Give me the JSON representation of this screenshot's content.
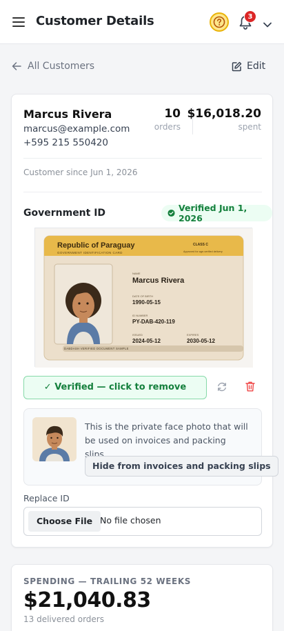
{
  "header": {
    "title": "Customer Details",
    "notification_count": "3",
    "icons": [
      "menu-icon",
      "help-icon",
      "bell-icon",
      "chevron-down-icon"
    ]
  },
  "nav": {
    "back_label": "All Customers",
    "edit_label": "Edit"
  },
  "customer": {
    "name": "Marcus Rivera",
    "email": "marcus@example.com",
    "phone": "+595 215 550420",
    "orders_count": "10",
    "orders_label": "orders",
    "spent_value": "$16,018.20",
    "spent_label": "spent",
    "since": "Customer since Jun 1, 2026"
  },
  "government_id": {
    "title": "Government ID",
    "badge": "Verified Jun 1, 2026",
    "card": {
      "country": "Republic of Paraguay",
      "subtitle": "GOVERNMENT IDENTIFICATION CARD",
      "class_label": "CLASS C",
      "approved_note": "Approved for age-verified delivery",
      "name_label": "NAME",
      "name": "Marcus Rivera",
      "dob_label": "DATE OF BIRTH",
      "dob": "1990-05-15",
      "id_label": "ID NUMBER",
      "id_number": "PY-DAB-420-119",
      "issued_label": "ISSUED",
      "issued": "2024-05-12",
      "expires_label": "EXPIRES",
      "expires": "2030-05-12",
      "footer": "DABDASH VERIFIED DOCUMENT SAMPLE"
    },
    "verified_button": "✓ Verified — click to remove",
    "face_note": "This is the private face photo that will be used on invoices and packing slips.",
    "hide_button": "Hide from invoices and packing slips",
    "replace_label": "Replace ID",
    "choose_file": "Choose File",
    "no_file": "No file chosen"
  },
  "spending": {
    "label": "SPENDING — TRAILING 52 WEEKS",
    "total": "$21,040.83",
    "orders": "13 delivered orders"
  },
  "colors": {
    "accent_green": "#15803d",
    "badge_red": "#dc2626",
    "help_yellow": "#eab308",
    "card_gold": "#e8b94a"
  }
}
